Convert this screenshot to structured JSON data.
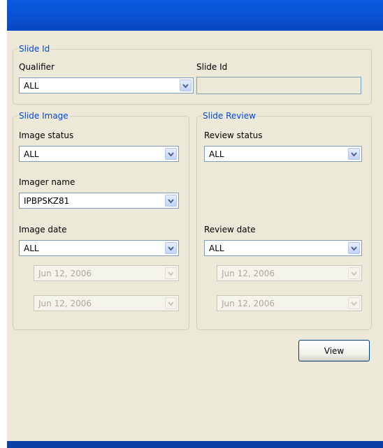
{
  "slide_id_group": {
    "legend": "Slide Id",
    "qualifier_label": "Qualifier",
    "qualifier_value": "ALL",
    "slide_id_label": "Slide Id",
    "slide_id_value": ""
  },
  "slide_image_group": {
    "legend": "Slide Image",
    "image_status_label": "Image status",
    "image_status_value": "ALL",
    "imager_name_label": "Imager name",
    "imager_name_value": "IPBPSKZ81",
    "image_date_label": "Image date",
    "image_date_value": "ALL",
    "date_from": "Jun 12, 2006",
    "date_to": "Jun 12, 2006"
  },
  "slide_review_group": {
    "legend": "Slide Review",
    "review_status_label": "Review status",
    "review_status_value": "ALL",
    "review_date_label": "Review date",
    "review_date_value": "ALL",
    "date_from": "Jun 12, 2006",
    "date_to": "Jun 12, 2006"
  },
  "view_button_label": "View",
  "icons": {
    "dropdown": "chevron-down-icon"
  },
  "colors": {
    "title_bar": "#0b4fd1",
    "panel": "#ece9d8",
    "legend_text": "#0046d5"
  }
}
